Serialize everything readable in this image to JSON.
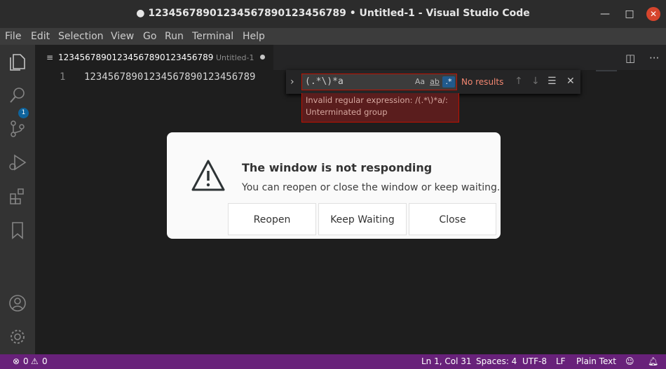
{
  "window": {
    "title": "● 12345678901234567890123456789 • Untitled-1 - Visual Studio Code",
    "minimize_glyph": "—",
    "maximize_glyph": "□",
    "close_glyph": "✕"
  },
  "menubar": {
    "items": [
      "File",
      "Edit",
      "Selection",
      "View",
      "Go",
      "Run",
      "Terminal",
      "Help"
    ]
  },
  "activity": {
    "explorer_badge": "1",
    "icons": [
      "files-icon",
      "search-icon",
      "source-control-icon",
      "run-debug-icon",
      "extensions-icon",
      "bookmark-icon",
      "account-icon",
      "settings-gear-icon"
    ]
  },
  "tab": {
    "name": "12345678901234567890123456789",
    "description": "Untitled-1"
  },
  "editor": {
    "line_number": "1",
    "line_text": "12345678901234567890123456789"
  },
  "find": {
    "value": "(.*\\)*a",
    "opt_case": "Aa",
    "opt_word": "ab",
    "opt_regex": ".*",
    "results": "No results",
    "error_line1": "Invalid regular expression: /(.*\\)*a/:",
    "error_line2": "Unterminated group"
  },
  "dialog": {
    "title": "The window is not responding",
    "message": "You can reopen or close the window or keep waiting.",
    "buttons": [
      "Reopen",
      "Keep Waiting",
      "Close"
    ]
  },
  "statusbar": {
    "errors": "0",
    "warnings": "0",
    "position": "Ln 1, Col 31",
    "spaces": "Spaces: 4",
    "encoding": "UTF-8",
    "eol": "LF",
    "language": "Plain Text"
  },
  "colors": {
    "statusbar": "#68217a",
    "titlebar": "#2c2c2c",
    "menubar": "#3c3c3c",
    "activitybar": "#333333",
    "editor": "#1e1e1e",
    "error": "#be1100",
    "accent": "#0e639c"
  }
}
